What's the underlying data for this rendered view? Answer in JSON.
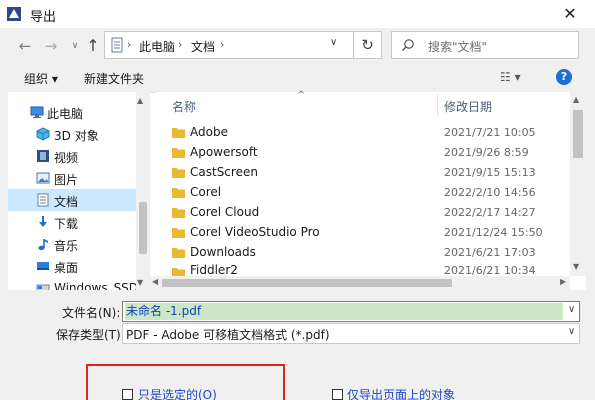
{
  "window": {
    "title": "导出",
    "close_glyph": "✕"
  },
  "nav": {
    "back_glyph": "←",
    "forward_glyph": "→",
    "history_glyph": "∨",
    "up_glyph": "↑",
    "breadcrumb": [
      "此电脑",
      "文档"
    ],
    "breadcrumb_sep": "›",
    "dropdown_glyph": "∨",
    "refresh_glyph": "↻",
    "search_placeholder": "搜索\"文档\""
  },
  "toolbar": {
    "organize_label": "组织 ▾",
    "new_folder_label": "新建文件夹",
    "view_glyph": "☷ ▾",
    "help_glyph": "?"
  },
  "tree": {
    "items": [
      {
        "label": "此电脑",
        "icon": "computer-icon"
      },
      {
        "label": "3D 对象",
        "icon": "cube-icon"
      },
      {
        "label": "视频",
        "icon": "film-icon"
      },
      {
        "label": "图片",
        "icon": "picture-icon"
      },
      {
        "label": "文档",
        "icon": "document-icon",
        "selected": true
      },
      {
        "label": "下载",
        "icon": "download-icon"
      },
      {
        "label": "音乐",
        "icon": "music-icon"
      },
      {
        "label": "桌面",
        "icon": "desktop-icon"
      },
      {
        "label": "Windows_SSD (C",
        "icon": "drive-icon"
      }
    ]
  },
  "filelist": {
    "col_name": "名称",
    "col_date": "修改日期",
    "sort_glyph": "^",
    "rows": [
      {
        "name": "Adobe",
        "date": "2021/7/21 10:05"
      },
      {
        "name": "Apowersoft",
        "date": "2021/9/26 8:59"
      },
      {
        "name": "CastScreen",
        "date": "2021/9/15 15:13"
      },
      {
        "name": "Corel",
        "date": "2022/2/10 14:56"
      },
      {
        "name": "Corel Cloud",
        "date": "2022/2/17 14:27"
      },
      {
        "name": "Corel VideoStudio Pro",
        "date": "2021/12/24 15:50"
      },
      {
        "name": "Downloads",
        "date": "2021/6/21 17:03"
      },
      {
        "name": "Fiddler2",
        "date": "2021/6/21 10:34"
      }
    ]
  },
  "save": {
    "filename_label": "文件名(N):",
    "filename_value": "未命名 -1.pdf",
    "filetype_label": "保存类型(T):",
    "filetype_value": "PDF - Adobe 可移植文档格式 (*.pdf)",
    "caret_glyph": "∨"
  },
  "options": {
    "selected_only_label": "只是选定的(O)",
    "export_page_objects_label": "仅导出页面上的对象"
  },
  "colors": {
    "folder": "#e8b931",
    "highlight_border": "#e0251b",
    "selection": "#cce8ff",
    "filename_highlight": "#cbe7c6",
    "link_blue": "#1f45c8"
  }
}
